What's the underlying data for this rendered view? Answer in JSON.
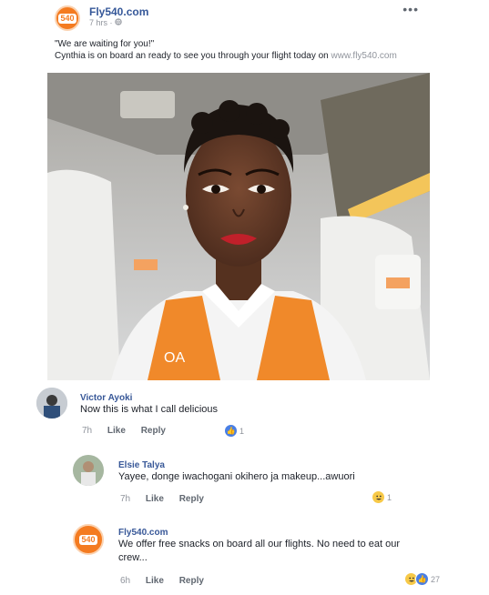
{
  "post": {
    "page_name": "Fly540.com",
    "logo_text": "540",
    "time": "7 hrs",
    "separator": "·",
    "more_label": "•••",
    "line1": "\"We are waiting for you!\"",
    "line2": "Cynthia is on board an ready to see you through your flight today on ",
    "link": "www.fly540.com"
  },
  "comments": [
    {
      "name": "Victor Ayoki",
      "text": "Now this is what I call delicious",
      "time": "7h",
      "like": "Like",
      "reply": "Reply",
      "reaction_count": "1"
    },
    {
      "name": "Elsie Talya",
      "text": "Yayee, donge iwachogani okihero ja makeup...awuori",
      "time": "7h",
      "like": "Like",
      "reply": "Reply",
      "reaction_count": "1"
    },
    {
      "name": "Fly540.com",
      "text": "We offer free snacks on board all our flights. No need to eat our crew...",
      "time": "6h",
      "like": "Like",
      "reply": "Reply",
      "reaction_count": "27"
    }
  ],
  "colors": {
    "brand": "#f47b20",
    "link_blue": "#385898",
    "like_blue": "#4a7fe4"
  }
}
